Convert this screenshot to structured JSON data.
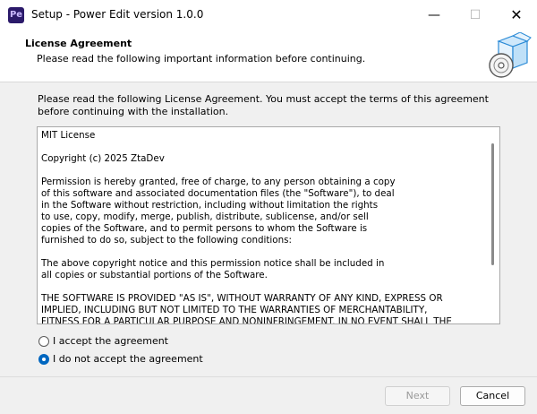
{
  "window": {
    "app_icon_text": "Pe",
    "title": "Setup - Power Edit version 1.0.0",
    "minimize_glyph": "—",
    "maximize_glyph": "☐",
    "close_glyph": "✕"
  },
  "header": {
    "title": "License Agreement",
    "subtitle": "Please read the following important information before continuing.",
    "graphic_icon": "install-box-disc-icon"
  },
  "intro": "Please read the following License Agreement. You must accept the terms of this agreement before continuing with the installation.",
  "license_text": "MIT License\n\nCopyright (c) 2025 ZtaDev\n\nPermission is hereby granted, free of charge, to any person obtaining a copy\nof this software and associated documentation files (the \"Software\"), to deal\nin the Software without restriction, including without limitation the rights\nto use, copy, modify, merge, publish, distribute, sublicense, and/or sell\ncopies of the Software, and to permit persons to whom the Software is\nfurnished to do so, subject to the following conditions:\n\nThe above copyright notice and this permission notice shall be included in\nall copies or substantial portions of the Software.\n\nTHE SOFTWARE IS PROVIDED \"AS IS\", WITHOUT WARRANTY OF ANY KIND, EXPRESS OR\nIMPLIED, INCLUDING BUT NOT LIMITED TO THE WARRANTIES OF MERCHANTABILITY,\nFITNESS FOR A PARTICULAR PURPOSE AND NONINFRINGEMENT. IN NO EVENT SHALL THE",
  "options": {
    "accept": "I accept the agreement",
    "decline": "I do not accept the agreement",
    "selected": "decline"
  },
  "buttons": {
    "next": "Next",
    "cancel": "Cancel"
  },
  "colors": {
    "accent": "#0067c0",
    "icon_bg": "#2b1a6a"
  }
}
